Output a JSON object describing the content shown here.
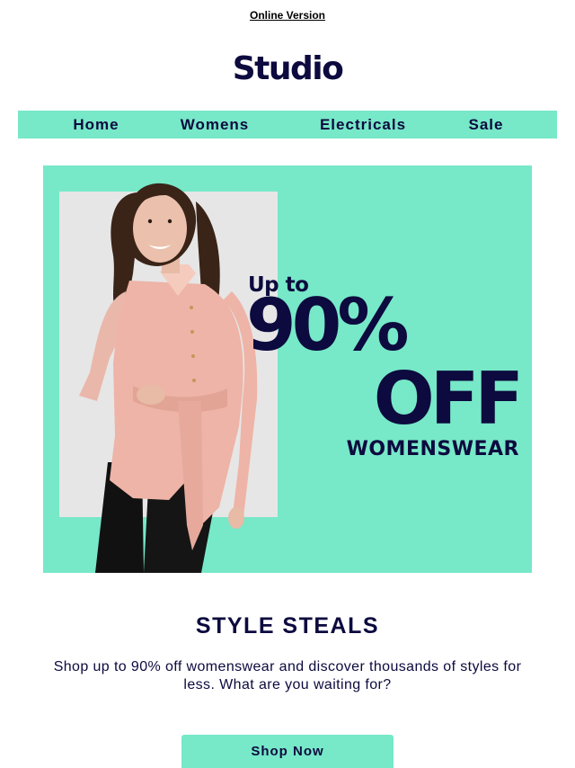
{
  "header": {
    "online_version": "Online Version",
    "logo": "Studio"
  },
  "nav": {
    "items": [
      {
        "label": "Home"
      },
      {
        "label": "Womens"
      },
      {
        "label": "Electricals"
      },
      {
        "label": "Sale"
      }
    ]
  },
  "hero": {
    "up_to": "Up to",
    "percent": "90%",
    "off": "OFF",
    "category": "WOMENSWEAR",
    "image": "model-in-pink-blouse-photo"
  },
  "content": {
    "heading": "STYLE STEALS",
    "body": "Shop up to 90% off womenswear and discover thousands of styles for less. What are you waiting for?",
    "cta": "Shop Now"
  },
  "colors": {
    "accent": "#77e8c8",
    "navy": "#0c0a3e",
    "photo_bg": "#e6e6e6"
  }
}
